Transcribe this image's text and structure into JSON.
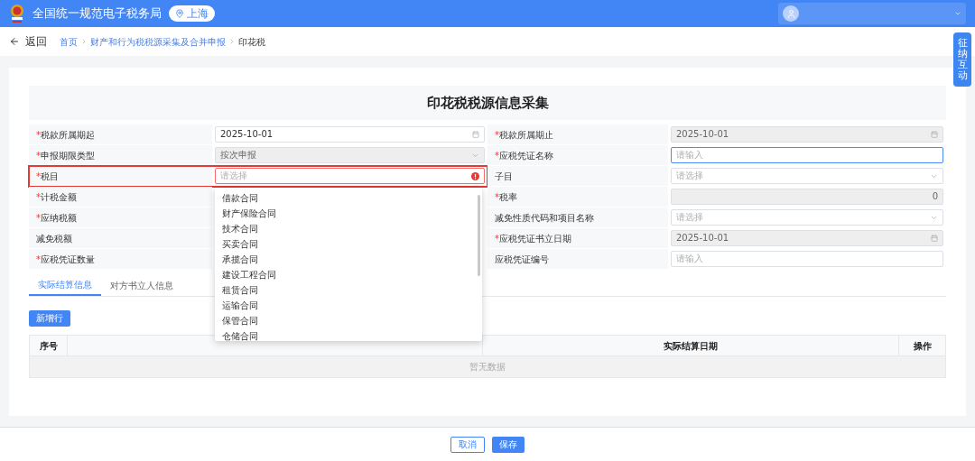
{
  "header": {
    "title": "全国统一规范电子税务局",
    "region": "上海"
  },
  "nav": {
    "back": "返回",
    "breadcrumb": [
      {
        "label": "首页",
        "kind": "link"
      },
      {
        "label": "财产和行为税税源采集及合并申报",
        "kind": "link"
      },
      {
        "label": "印花税",
        "kind": "current"
      }
    ]
  },
  "side_tab": {
    "label": "征纳互动"
  },
  "form": {
    "title": "印花税税源信息采集",
    "left": [
      {
        "mark": "*",
        "label": "税款所属期起",
        "kind": "date",
        "value": "2025-10-01",
        "disabled": false,
        "highlighted": false,
        "error": false,
        "open": false
      },
      {
        "mark": "*",
        "label": "申报期限类型",
        "kind": "select",
        "value": "按次申报",
        "disabled": true,
        "highlighted": false,
        "error": false,
        "open": false
      },
      {
        "mark": "*",
        "label": "税目",
        "kind": "select",
        "placeholder": "请选择",
        "disabled": false,
        "highlighted": true,
        "error": true,
        "open": true,
        "options": [
          "借款合同",
          "财产保险合同",
          "技术合同",
          "买卖合同",
          "承揽合同",
          "建设工程合同",
          "租赁合同",
          "运输合同",
          "保管合同",
          "仓储合同"
        ]
      },
      {
        "mark": "*",
        "label": "计税金额",
        "kind": "hidden"
      },
      {
        "mark": "*",
        "label": "应纳税额",
        "kind": "hidden"
      },
      {
        "label": "减免税额",
        "kind": "hidden"
      },
      {
        "mark": "*",
        "label": "应税凭证数量",
        "kind": "hidden"
      }
    ],
    "right": [
      {
        "mark": "*",
        "label": "税款所属期止",
        "kind": "date",
        "value": "2025-10-01",
        "disabled": true,
        "highlighted": false,
        "error": false,
        "open": false
      },
      {
        "mark": "*",
        "label": "应税凭证名称",
        "kind": "input",
        "placeholder": "请输入",
        "disabled": false,
        "focused": true,
        "highlighted": false,
        "error": false,
        "open": false
      },
      {
        "label": "子目",
        "kind": "select",
        "placeholder": "请选择",
        "disabled": false,
        "highlighted": false,
        "error": false,
        "open": false
      },
      {
        "mark": "*",
        "label": "税率",
        "kind": "number",
        "value": "0",
        "disabled": true,
        "highlighted": false,
        "error": false,
        "open": false
      },
      {
        "label": "减免性质代码和项目名称",
        "kind": "select",
        "placeholder": "请选择",
        "disabled": false,
        "highlighted": false,
        "error": false,
        "open": false
      },
      {
        "mark": "*",
        "label": "应税凭证书立日期",
        "kind": "date",
        "value": "2025-10-01",
        "disabled": true,
        "highlighted": false,
        "error": false,
        "open": false
      },
      {
        "label": "应税凭证编号",
        "kind": "input",
        "placeholder": "请输入",
        "disabled": false,
        "focused": false,
        "highlighted": false,
        "error": false,
        "open": false
      }
    ]
  },
  "tabs": [
    {
      "label": "实际结算信息",
      "selected": true
    },
    {
      "label": "对方书立人信息",
      "selected": false
    }
  ],
  "add_row_button": "新增行",
  "table": {
    "columns": [
      {
        "label": "序号",
        "kind": "narrow"
      },
      {
        "kind": "hidden"
      },
      {
        "label": "实际结算日期",
        "kind": "wide"
      },
      {
        "label": "操作",
        "kind": "narrow"
      }
    ],
    "empty": "暂无数据"
  },
  "footer": {
    "buttons": [
      {
        "label": "取消",
        "kind": "secondary"
      },
      {
        "label": "保存",
        "kind": "primary"
      }
    ]
  }
}
